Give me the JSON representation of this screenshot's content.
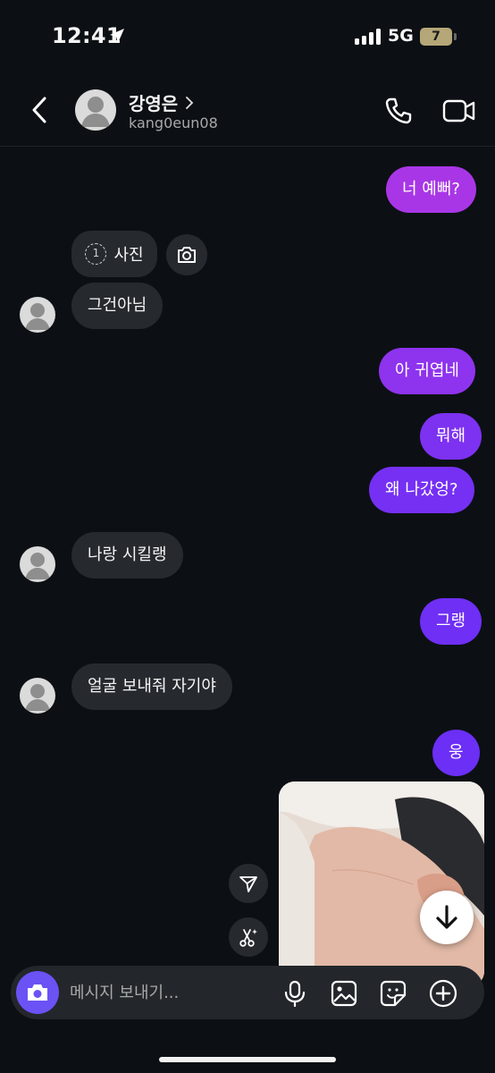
{
  "status_bar": {
    "time": "12:41",
    "network": "5G",
    "battery": "7"
  },
  "header": {
    "contact_name": "강영은",
    "contact_handle": "kang0eun08"
  },
  "colors": {
    "bubble_top": "#a936e6",
    "bubble_bottom": "#6b2ff5",
    "incoming_bubble": "#262a2f",
    "accent": "#6a52f5",
    "background": "#0c1014"
  },
  "messages": {
    "m1": "너 예뻐?",
    "photo_label": "사진",
    "photo_once_marker": "1",
    "m2": "그건아님",
    "m3": "아 귀엽네",
    "m4": "뭐해",
    "m5": "왜 나갔엉?",
    "m6": "나랑 시킬랭",
    "m7": "그랭",
    "m8": "얼굴 보내줘 자기야",
    "m9": "웅"
  },
  "composer": {
    "placeholder": "메시지 보내기..."
  },
  "icons": [
    "back-icon",
    "chevron-right-icon",
    "phone-icon",
    "video-camera-icon",
    "camera-icon",
    "send-icon",
    "scissors-sparkle-icon",
    "arrow-down-icon",
    "microphone-icon",
    "image-icon",
    "sticker-icon",
    "plus-circle-icon"
  ]
}
